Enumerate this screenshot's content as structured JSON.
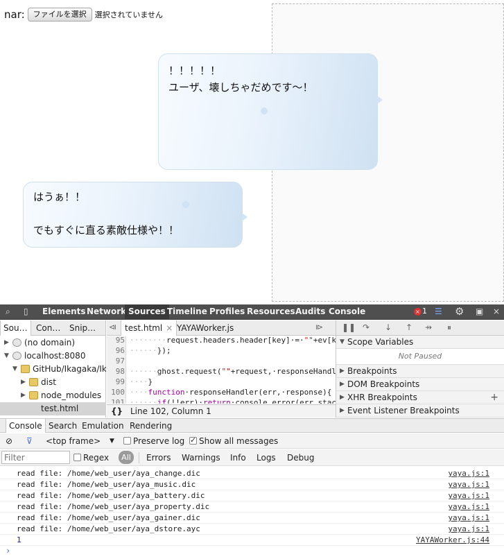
{
  "file_input": {
    "label": "nar:",
    "button": "ファイルを選択",
    "status": "選択されていません"
  },
  "balloons": {
    "top": "！！！！！\nユーザ、壊しちゃだめです〜！",
    "bottom": "はうぁ！！\n\nでもすぐに直る素敵仕様や！！"
  },
  "devtools": {
    "tabs": [
      "Elements",
      "Network",
      "Sources",
      "Timeline",
      "Profiles",
      "Resources",
      "Audits",
      "Console"
    ],
    "active_tab": "Sources",
    "error_count": "1",
    "colors": {
      "toolbar_bg": "#4f4f4f",
      "error": "#d33",
      "keyword": "#a0a",
      "string": "#c41a16",
      "link": "#3b6bd8"
    },
    "nav_tabs": [
      "Sou…",
      "Con…",
      "Snip…"
    ],
    "tree": [
      {
        "label": "(no domain)",
        "type": "globe",
        "depth": 0,
        "arrow": "▶"
      },
      {
        "label": "localhost:8080",
        "type": "globe",
        "depth": 0,
        "arrow": "▼"
      },
      {
        "label": "GitHub/Ikagaka/Ik",
        "type": "folder",
        "depth": 1,
        "arrow": "▼"
      },
      {
        "label": "dist",
        "type": "folder",
        "depth": 2,
        "arrow": "▶"
      },
      {
        "label": "node_modules",
        "type": "folder",
        "depth": 2,
        "arrow": "▶"
      },
      {
        "label": "test.html",
        "type": "file",
        "depth": 2,
        "arrow": ""
      }
    ],
    "editor_tabs": [
      {
        "label": "test.html",
        "close": "×"
      },
      {
        "label": "YAYAWorker.js",
        "close": ""
      }
    ],
    "code_lines": [
      {
        "n": "95",
        "parts": [
          [
            "ws",
            "········"
          ],
          [
            "",
            "request.headers.header[key]·=·"
          ],
          [
            "str",
            "\"\""
          ],
          [
            "",
            "+ev[k"
          ]
        ]
      },
      {
        "n": "96",
        "parts": [
          [
            "ws",
            "······"
          ],
          [
            "",
            "});"
          ]
        ]
      },
      {
        "n": "97",
        "parts": [
          [
            "",
            ""
          ]
        ]
      },
      {
        "n": "98",
        "parts": [
          [
            "ws",
            "······"
          ],
          [
            "",
            "ghost.request("
          ],
          [
            "str",
            "\"\""
          ],
          [
            "",
            "+request,·responseHandl"
          ]
        ]
      },
      {
        "n": "99",
        "parts": [
          [
            "ws",
            "····"
          ],
          [
            "",
            "}"
          ]
        ]
      },
      {
        "n": "100",
        "parts": [
          [
            "ws",
            "····"
          ],
          [
            "kw",
            "function"
          ],
          [
            "",
            "·responseHandler(err,·response){"
          ]
        ]
      },
      {
        "n": "101",
        "parts": [
          [
            "ws",
            "······"
          ],
          [
            "kw",
            "if"
          ],
          [
            "",
            "(!!err)·"
          ],
          [
            "kw",
            "return"
          ],
          [
            "",
            "·console.error(err.stac"
          ]
        ]
      },
      {
        "n": "102",
        "parts": [
          [
            "",
            ""
          ]
        ]
      }
    ],
    "status_brace": "{}",
    "status_position": "Line 102, Column 1",
    "sidebar_panes": [
      {
        "title": "Scope Variables",
        "expanded": true,
        "plus": false
      },
      {
        "title": "Breakpoints",
        "expanded": false,
        "plus": false
      },
      {
        "title": "DOM Breakpoints",
        "expanded": false,
        "plus": false
      },
      {
        "title": "XHR Breakpoints",
        "expanded": false,
        "plus": true
      },
      {
        "title": "Event Listener Breakpoints",
        "expanded": false,
        "plus": false
      }
    ],
    "not_paused": "Not Paused",
    "drawer_tabs": [
      "Console",
      "Search",
      "Emulation",
      "Rendering"
    ],
    "frame_select": "<top frame>",
    "preserve_log": "Preserve log",
    "show_all": "Show all messages",
    "filter_placeholder": "Filter",
    "regex": "Regex",
    "levels": [
      "All",
      "Errors",
      "Warnings",
      "Info",
      "Logs",
      "Debug"
    ],
    "messages": [
      {
        "text": "read file: /home/web_user/aya_change.dic",
        "source": "yaya.js:1"
      },
      {
        "text": "read file: /home/web_user/aya_music.dic",
        "source": "yaya.js:1"
      },
      {
        "text": "read file: /home/web_user/aya_battery.dic",
        "source": "yaya.js:1"
      },
      {
        "text": "read file: /home/web_user/aya_property.dic",
        "source": "yaya.js:1"
      },
      {
        "text": "read file: /home/web_user/aya_gainer.dic",
        "source": "yaya.js:1"
      },
      {
        "text": "read file: /home/web_user/aya_dstore.ayc",
        "source": "yaya.js:1"
      }
    ],
    "result": {
      "text": "1",
      "source": "YAYAWorker.js:44"
    },
    "prompt": "›"
  }
}
